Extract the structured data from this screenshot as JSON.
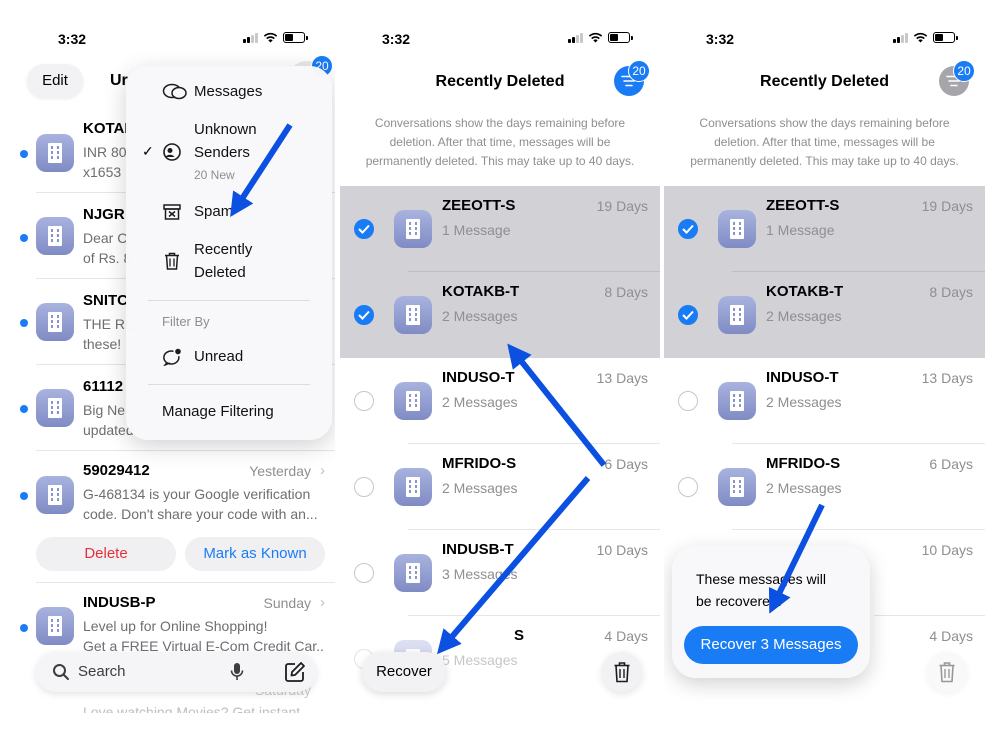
{
  "status": {
    "time": "3:32"
  },
  "screen1": {
    "edit_label": "Edit",
    "title_partial": "Ur",
    "filter_badge": "20",
    "dropdown": {
      "messages": "Messages",
      "unknown_line1": "Unknown",
      "unknown_line2": "Senders",
      "unknown_sub": "20 New",
      "spam": "Spam",
      "recent_line1": "Recently",
      "recent_line2": "Deleted",
      "filter_by": "Filter By",
      "unread": "Unread",
      "manage": "Manage Filtering"
    },
    "conversations": [
      {
        "name": "KOTAI",
        "l1": "INR 80",
        "l2": "x1653"
      },
      {
        "name": "NJGR",
        "l1": "Dear C",
        "l2": "of Rs. 8"
      },
      {
        "name": "SNITC",
        "l1": "THE RE",
        "l2": "these!"
      },
      {
        "name": "61112",
        "l1": "Big Ne",
        "l2": "updated"
      },
      {
        "name": "59029412",
        "date": "Yesterday",
        "l1": "G-468134 is your Google verification",
        "l2": "code. Don't share your code with an..."
      },
      {
        "name": "INDUSB-P",
        "date": "Sunday",
        "l1": "Level up for Online Shopping!",
        "l2": "Get a FREE Virtual E-Com Credit Car..."
      }
    ],
    "peek": {
      "date": "Saturday",
      "l2": "Love watching Movies? Get instant"
    },
    "delete_label": "Delete",
    "mark_label": "Mark as Known",
    "search_placeholder": "Search"
  },
  "recently_deleted": {
    "title": "Recently Deleted",
    "note_l1": "Conversations show the days remaining before",
    "note_l2": "deletion. After that time, messages will be",
    "note_l3": "permanently deleted. This may take up to 40 days.",
    "badge": "20",
    "items": [
      {
        "name": "ZEEOTT-S",
        "count": "1 Message",
        "days": "19 Days"
      },
      {
        "name": "KOTAKB-T",
        "count": "2 Messages",
        "days": "8 Days"
      },
      {
        "name": "INDUSO-T",
        "count": "2 Messages",
        "days": "13 Days"
      },
      {
        "name": "MFRIDO-S",
        "count": "2 Messages",
        "days": "6 Days"
      },
      {
        "name": "INDUSB-T",
        "count": "3 Messages",
        "days": "10 Days"
      },
      {
        "name": "S",
        "count": "5 Messages",
        "days": "4 Days"
      }
    ],
    "recover_label": "Recover",
    "popup_l1": "These messages will",
    "popup_l2": "be recovered.",
    "popup_button": "Recover 3 Messages"
  },
  "colors": {
    "accent": "#1a7cf5",
    "selection": "#d1d1d6",
    "danger": "#e5303b",
    "annotation": "#0b50e0"
  }
}
